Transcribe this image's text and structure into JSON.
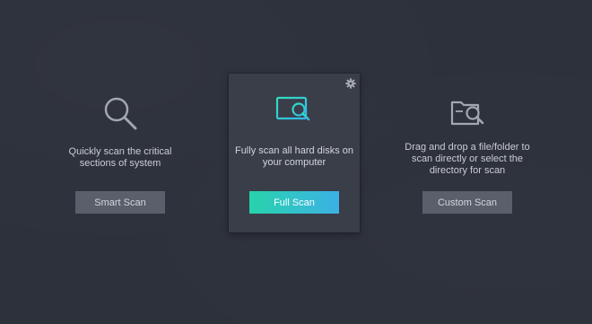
{
  "scan_options": {
    "smart": {
      "description": "Quickly scan the critical\nsections of system",
      "button_label": "Smart Scan"
    },
    "full": {
      "description": "Fully scan all hard disks on\nyour computer",
      "button_label": "Full Scan"
    },
    "custom": {
      "description": "Drag and drop a file/folder to\nscan directly or select the\ndirectory for scan",
      "button_label": "Custom Scan"
    }
  },
  "icons": {
    "smart": "magnifier-icon",
    "full": "monitor-search-icon",
    "custom": "folder-search-icon",
    "settings": "gear-icon"
  },
  "colors": {
    "background": "#2d313b",
    "card": "#3a3e49",
    "accent_start": "#27d3ab",
    "accent_end": "#3cb0e4",
    "secondary_button": "#5a5f6b"
  }
}
